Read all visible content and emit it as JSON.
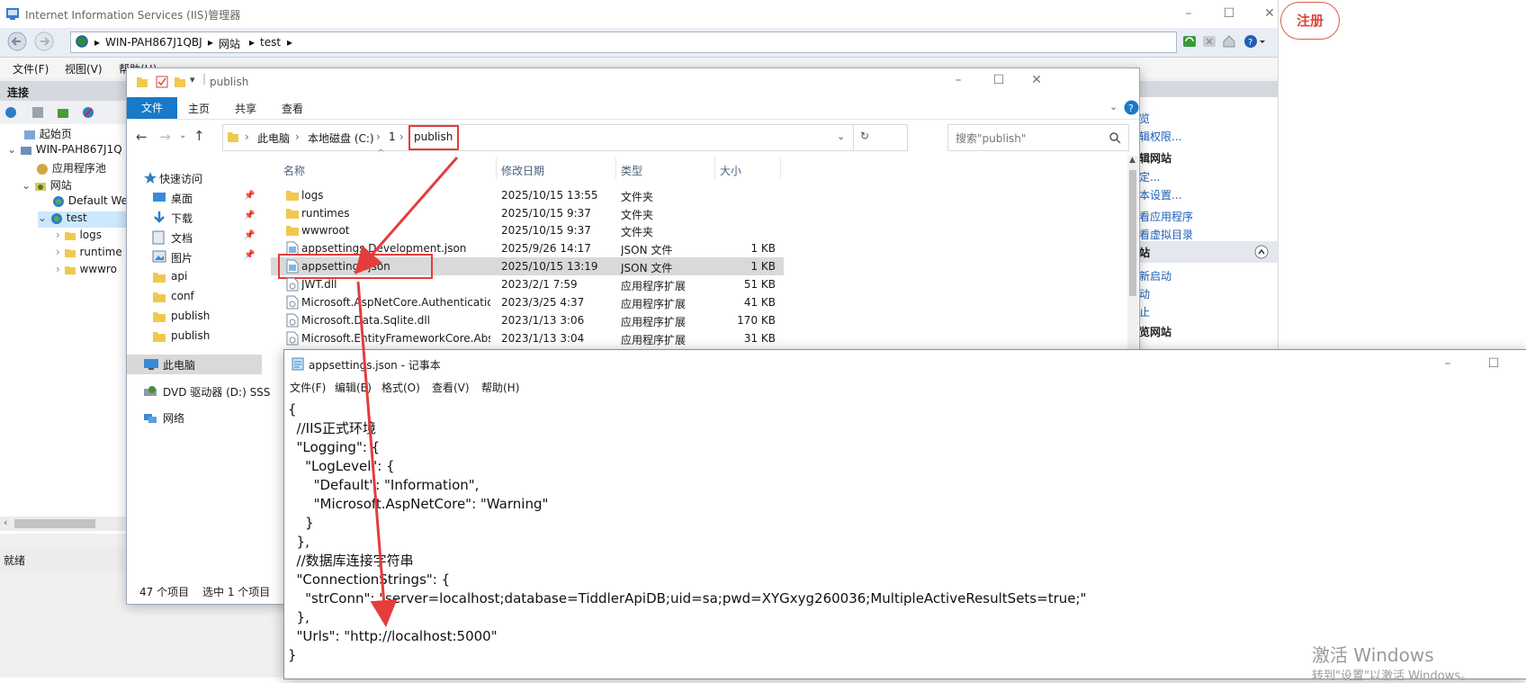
{
  "iis": {
    "title": "Internet Information Services (IIS)管理器",
    "breadcrumb": [
      "WIN-PAH867J1QBJ",
      "网站",
      "test"
    ],
    "menu": [
      "文件(F)",
      "视图(V)",
      "帮助(H)"
    ],
    "connections_label": "连接",
    "tree": [
      {
        "label": "起始页"
      },
      {
        "label": "WIN-PAH867J1Q"
      },
      {
        "label": "应用程序池"
      },
      {
        "label": "网站"
      },
      {
        "label": "Default We"
      },
      {
        "label": "test"
      },
      {
        "label": "logs"
      },
      {
        "label": "runtime"
      },
      {
        "label": "wwwro"
      }
    ],
    "status": "就绪",
    "right_panel": {
      "items": [
        "览",
        "辑权限...",
        "辑网站",
        "定...",
        "本设置...",
        "看应用程序",
        "看虚拟目录",
        "站",
        "新启动",
        "动",
        "止",
        "览网站"
      ]
    },
    "register_label": "注册"
  },
  "explorer": {
    "title": "publish",
    "tabs": [
      "文件",
      "主页",
      "共享",
      "查看"
    ],
    "address": [
      "此电脑",
      "本地磁盘 (C:)",
      "1",
      "publish"
    ],
    "search_placeholder": "搜索\"publish\"",
    "columns": {
      "name": "名称",
      "date": "修改日期",
      "type": "类型",
      "size": "大小"
    },
    "nav": {
      "quick_access": "快速访问",
      "items": [
        "桌面",
        "下载",
        "文档",
        "图片",
        "api",
        "conf",
        "publish",
        "publish"
      ],
      "this_pc": "此电脑",
      "dvd": "DVD 驱动器 (D:) SSS",
      "network": "网络"
    },
    "files": [
      {
        "name": "logs",
        "date": "2025/10/15 13:55",
        "type": "文件夹",
        "size": "",
        "icon": "folder"
      },
      {
        "name": "runtimes",
        "date": "2025/10/15 9:37",
        "type": "文件夹",
        "size": "",
        "icon": "folder"
      },
      {
        "name": "wwwroot",
        "date": "2025/10/15 9:37",
        "type": "文件夹",
        "size": "",
        "icon": "folder"
      },
      {
        "name": "appsettings.Development.json",
        "date": "2025/9/26 14:17",
        "type": "JSON 文件",
        "size": "1 KB",
        "icon": "file"
      },
      {
        "name": "appsettings.json",
        "date": "2025/10/15 13:19",
        "type": "JSON 文件",
        "size": "1 KB",
        "icon": "file"
      },
      {
        "name": "JWT.dll",
        "date": "2023/2/1 7:59",
        "type": "应用程序扩展",
        "size": "51 KB",
        "icon": "dll"
      },
      {
        "name": "Microsoft.AspNetCore.Authentication...",
        "date": "2023/3/25 4:37",
        "type": "应用程序扩展",
        "size": "41 KB",
        "icon": "dll"
      },
      {
        "name": "Microsoft.Data.Sqlite.dll",
        "date": "2023/1/13 3:06",
        "type": "应用程序扩展",
        "size": "170 KB",
        "icon": "dll"
      },
      {
        "name": "Microsoft.EntityFrameworkCore.Abstr...",
        "date": "2023/1/13 3:04",
        "type": "应用程序扩展",
        "size": "31 KB",
        "icon": "dll"
      }
    ],
    "status_count": "47 个项目",
    "status_selected": "选中 1 个项目"
  },
  "notepad": {
    "title": "appsettings.json - 记事本",
    "menu": [
      "文件(F)",
      "编辑(E)",
      "格式(O)",
      "查看(V)",
      "帮助(H)"
    ],
    "lines": [
      "{",
      "  //IIS正式环境",
      "  \"Logging\": {",
      "    \"LogLevel\": {",
      "      \"Default\": \"Information\",",
      "      \"Microsoft.AspNetCore\": \"Warning\"",
      "    }",
      "  },",
      "  //数据库连接字符串",
      "  \"ConnectionStrings\": {",
      "    \"strConn\": \"server=localhost;database=TiddlerApiDB;uid=sa;pwd=XYGxyg260036;MultipleActiveResultSets=true;\"",
      "  },",
      "  \"Urls\": \"http://localhost:5000\"",
      "}"
    ]
  },
  "watermark": {
    "line1": "激活 Windows",
    "line2": "转到\"设置\"以激活 Windows。"
  },
  "colors": {
    "highlight": "#e53c3c",
    "ribbon_blue": "#1979ca",
    "selected_row": "#cce8ff"
  }
}
